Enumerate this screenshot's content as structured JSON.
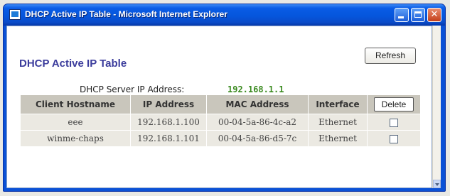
{
  "window": {
    "title": "DHCP Active IP Table - Microsoft Internet Explorer",
    "controls": [
      "minimize-icon",
      "maximize-icon",
      "close-icon"
    ]
  },
  "page": {
    "title": "DHCP Active IP Table",
    "refresh_label": "Refresh",
    "server_label": "DHCP Server IP Address:",
    "server_ip": "192.168.1.1"
  },
  "table": {
    "headers": {
      "hostname": "Client Hostname",
      "ip": "IP Address",
      "mac": "MAC Address",
      "interface": "Interface",
      "delete": "Delete"
    },
    "rows": [
      {
        "hostname": "eee",
        "ip": "192.168.1.100",
        "mac": "00-04-5a-86-4c-a2",
        "interface": "Ethernet",
        "selected": false
      },
      {
        "hostname": "winme-chaps",
        "ip": "192.168.1.101",
        "mac": "00-04-5a-86-d5-7c",
        "interface": "Ethernet",
        "selected": false
      }
    ]
  },
  "colors": {
    "title_bar": "#0556dc",
    "page_title": "#3b3c9c",
    "server_ip": "#3a8a1f",
    "header_bg": "#c9c6bc",
    "row_bg": "#ebe9e2"
  }
}
